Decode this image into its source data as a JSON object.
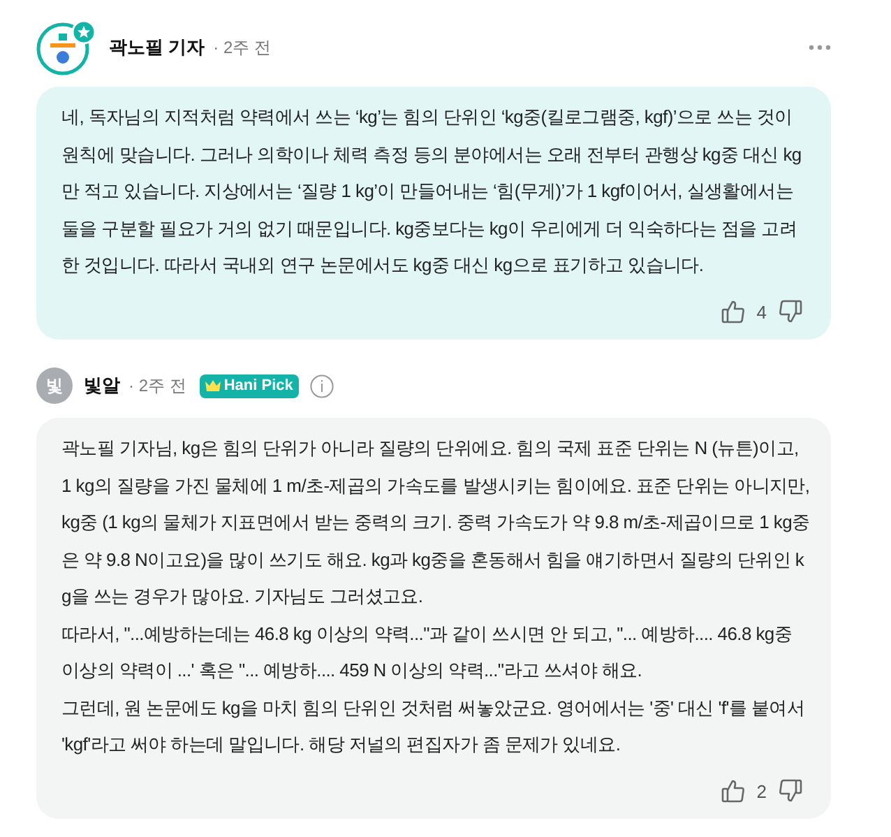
{
  "comments": [
    {
      "author": "곽노필 기자",
      "avatar": {
        "kind": "reporter"
      },
      "time": "· 2주 전",
      "highlighted": true,
      "paragraphs": [
        "네, 독자님의 지적처럼 약력에서 쓰는 ‘kg’는 힘의 단위인 ‘kg중(킬로그램중, kgf)’으로 쓰는 것이 원칙에 맞습니다. 그러나 의학이나 체력 측정 등의 분야에서는 오래 전부터 관행상 kg중 대신 kg만 적고 있습니다. 지상에서는 ‘질량 1 kg’이 만들어내는 ‘힘(무게)’가 1 kgf이어서, 실생활에서는 둘을 구분할 필요가 거의 없기 때문입니다. kg중보다는 kg이 우리에게 더 익숙하다는 점을 고려한 것입니다. 따라서 국내외 연구 논문에서도 kg중 대신 kg으로 표기하고 있습니다."
      ],
      "likes": "4",
      "menu": true
    },
    {
      "author": "빛알",
      "avatar": {
        "kind": "initial",
        "text": "빛"
      },
      "time": "· 2주 전",
      "badge": "Hani Pick",
      "highlighted": false,
      "paragraphs": [
        "곽노필 기자님, kg은 힘의 단위가 아니라 질량의 단위에요. 힘의 국제 표준 단위는 N (뉴튼)이고, 1 kg의 질량을 가진 물체에 1 m/초-제곱의 가속도를 발생시키는 힘이에요. 표준 단위는 아니지만, kg중 (1 kg의 물체가 지표면에서 받는 중력의 크기. 중력 가속도가 약 9.8 m/초-제곱이므로 1 kg중은 약 9.8 N이고요)을 많이 쓰기도 해요. kg과 kg중을 혼동해서 힘을 얘기하면서 질량의 단위인 kg을 쓰는 경우가 많아요. 기자님도 그러셨고요.",
        "따라서, \"...예방하는데는 46.8 kg 이상의 약력...\"과 같이 쓰시면 안 되고, \"... 예방하.... 46.8 kg중 이상의 약력이 ...' 혹은 \"... 예방하.... 459 N 이상의 약력...\"라고 쓰셔야 해요.",
        "그런데, 원 논문에도 kg을 마치 힘의 단위인 것처럼 써놓았군요. 영어에서는 '중' 대신 'f'를 붙여서 'kgf'라고 써야 하는데 말입니다. 해당 저널의 편집자가 좀 문제가 있네요."
      ],
      "likes": "2",
      "menu": false
    }
  ]
}
